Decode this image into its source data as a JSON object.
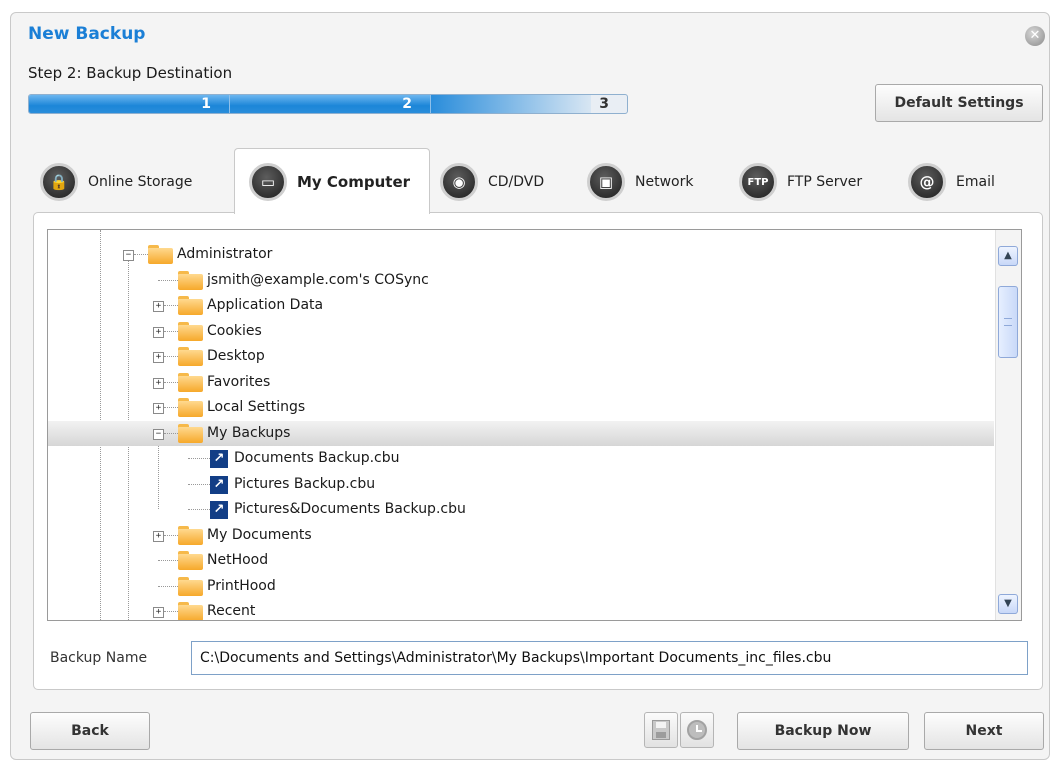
{
  "dialog": {
    "title": "New Backup",
    "step": "Step 2: Backup Destination",
    "close_glyph": "✕",
    "progress": {
      "segments": [
        "1",
        "2",
        "3"
      ],
      "current_step": 2,
      "total_steps": 3
    },
    "default_settings_label": "Default Settings"
  },
  "tabs": [
    {
      "label": "Online Storage",
      "icon": "lock-icon",
      "glyph": "🔒"
    },
    {
      "label": "My Computer",
      "icon": "monitor-icon",
      "glyph": "▭",
      "active": true
    },
    {
      "label": "CD/DVD",
      "icon": "disc-icon",
      "glyph": "◉"
    },
    {
      "label": "Network",
      "icon": "network-icon",
      "glyph": "▣"
    },
    {
      "label": "FTP Server",
      "icon": "ftp-icon",
      "glyph": "FTP"
    },
    {
      "label": "Email",
      "icon": "email-icon",
      "glyph": "@"
    }
  ],
  "tree": {
    "items": [
      {
        "label": "Administrator",
        "type": "folder",
        "expander": "−"
      },
      {
        "label": "jsmith@example.com's COSync",
        "type": "folder"
      },
      {
        "label": "Application Data",
        "type": "folder",
        "expander": "+"
      },
      {
        "label": "Cookies",
        "type": "folder",
        "expander": "+"
      },
      {
        "label": "Desktop",
        "type": "folder",
        "expander": "+"
      },
      {
        "label": "Favorites",
        "type": "folder",
        "expander": "+"
      },
      {
        "label": "Local Settings",
        "type": "folder",
        "expander": "+"
      },
      {
        "label": "My Backups",
        "type": "folder",
        "expander": "−",
        "selected": true
      },
      {
        "label": "Documents Backup.cbu",
        "type": "file"
      },
      {
        "label": "Pictures Backup.cbu",
        "type": "file"
      },
      {
        "label": "Pictures&Documents Backup.cbu",
        "type": "file"
      },
      {
        "label": "My Documents",
        "type": "folder",
        "expander": "+"
      },
      {
        "label": "NetHood",
        "type": "folder"
      },
      {
        "label": "PrintHood",
        "type": "folder"
      },
      {
        "label": "Recent",
        "type": "folder",
        "expander": "+"
      }
    ],
    "file_glyph": "↗",
    "scroll_up_glyph": "▲",
    "scroll_down_glyph": "▼"
  },
  "backup_name": {
    "label": "Backup Name",
    "value": "C:\\Documents and Settings\\Administrator\\My Backups\\Important Documents_inc_files.cbu"
  },
  "footer": {
    "back_label": "Back",
    "backup_now_label": "Backup Now",
    "next_label": "Next"
  },
  "colors": {
    "title": "#1b7fd6",
    "progress": "#1c86d8",
    "folder": "#f6a82a",
    "file_icon": "#123e86"
  }
}
